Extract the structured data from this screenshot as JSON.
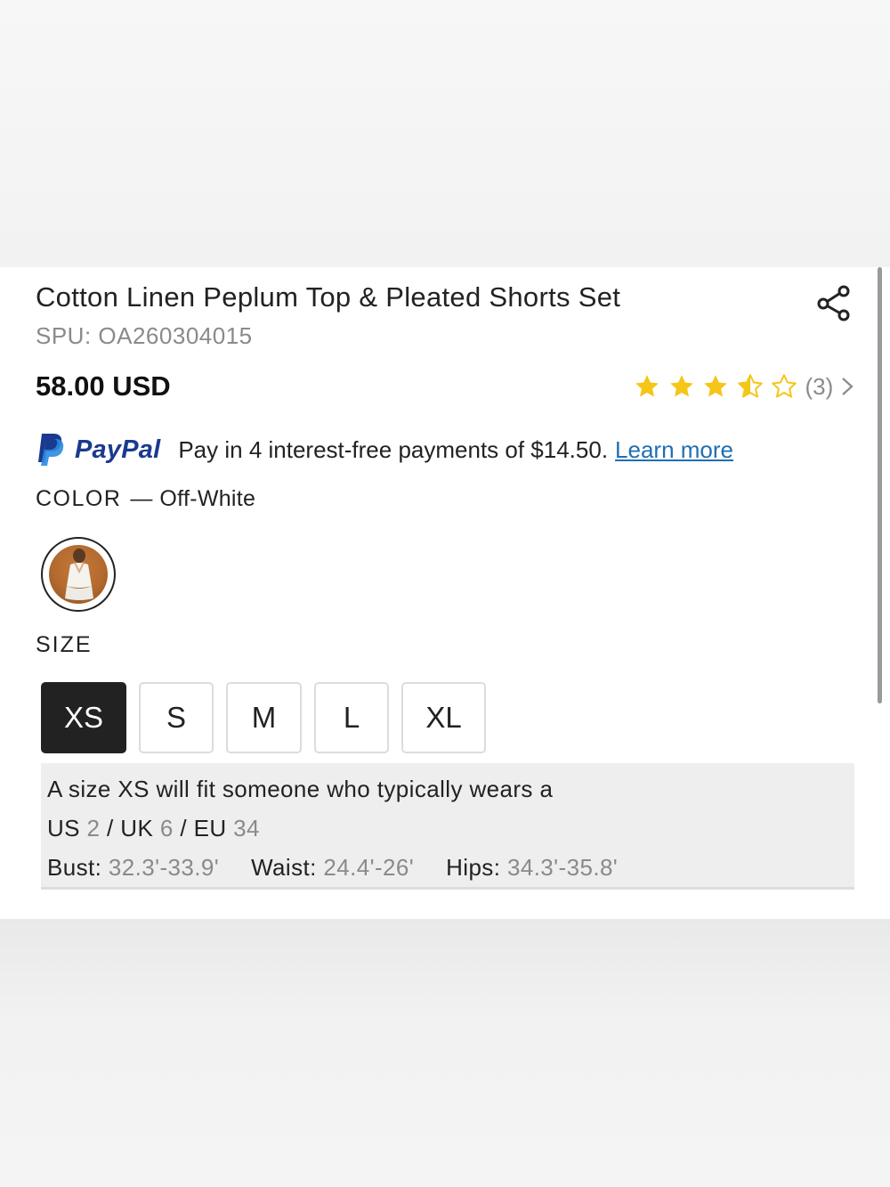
{
  "product": {
    "title": "Cotton Linen Peplum Top & Pleated Shorts Set",
    "spu": "SPU: OA260304015",
    "price": "58.00 USD",
    "rating": {
      "stars": 3.5,
      "max": 5,
      "count_label": "(3)"
    }
  },
  "paypal": {
    "brand": "PayPal",
    "message": "Pay in 4 interest-free payments of $14.50.",
    "link_label": "Learn more"
  },
  "color": {
    "label": "COLOR",
    "separator": "—",
    "selected": "Off-White"
  },
  "size": {
    "label": "SIZE",
    "options": [
      "XS",
      "S",
      "M",
      "L",
      "XL"
    ],
    "selected": "XS",
    "fit_text": "A size XS will fit someone who typically wears a",
    "us_label": "US",
    "us_value": "2",
    "uk_label": "UK",
    "uk_value": "6",
    "eu_label": "EU",
    "eu_value": "34",
    "bust_label": "Bust:",
    "bust_value": "32.3'-33.9'",
    "waist_label": "Waist:",
    "waist_value": "24.4'-26'",
    "hips_label": "Hips:",
    "hips_value": "34.3'-35.8'"
  },
  "icons": {
    "share": "share-icon",
    "star": "star-icon",
    "chevron": "chevron-right-icon",
    "paypal": "paypal-logo-icon"
  },
  "colors": {
    "star": "#F5C518",
    "link": "#1F6FB2",
    "paypal_dark": "#1A3A8F",
    "selected_size_bg": "#222222",
    "info_bg": "#EEEEEE"
  }
}
